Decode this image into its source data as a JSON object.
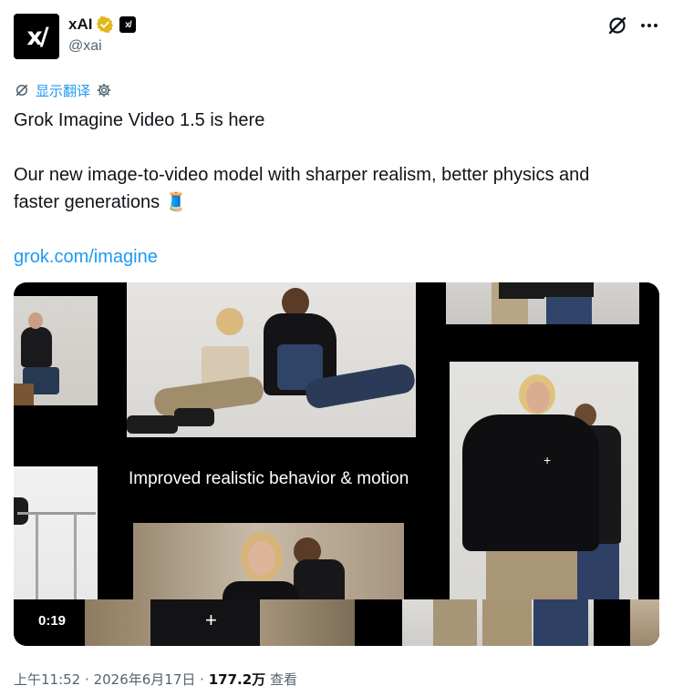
{
  "author": {
    "avatar_text": "x/",
    "display_name": "xAI",
    "handle": "@xai",
    "affiliation_badge": "x/"
  },
  "translate": {
    "label": "显示翻译"
  },
  "tweet": {
    "line1": "Grok Imagine Video 1.5 is here",
    "line2": "Our new image-to-video model with sharper realism, better physics and",
    "line3_text": "faster generations",
    "emoji": "🧵",
    "link": "grok.com/imagine"
  },
  "media": {
    "overlay_text": "Improved realistic behavior & motion",
    "duration": "0:19"
  },
  "meta": {
    "time": "上午11:52",
    "separator": "·",
    "date": "2026年6月17日",
    "views": "177.2万",
    "views_label": "查看"
  },
  "colors": {
    "link": "#1d9bf0",
    "verified": "#e2b719",
    "text_secondary": "#536471"
  }
}
